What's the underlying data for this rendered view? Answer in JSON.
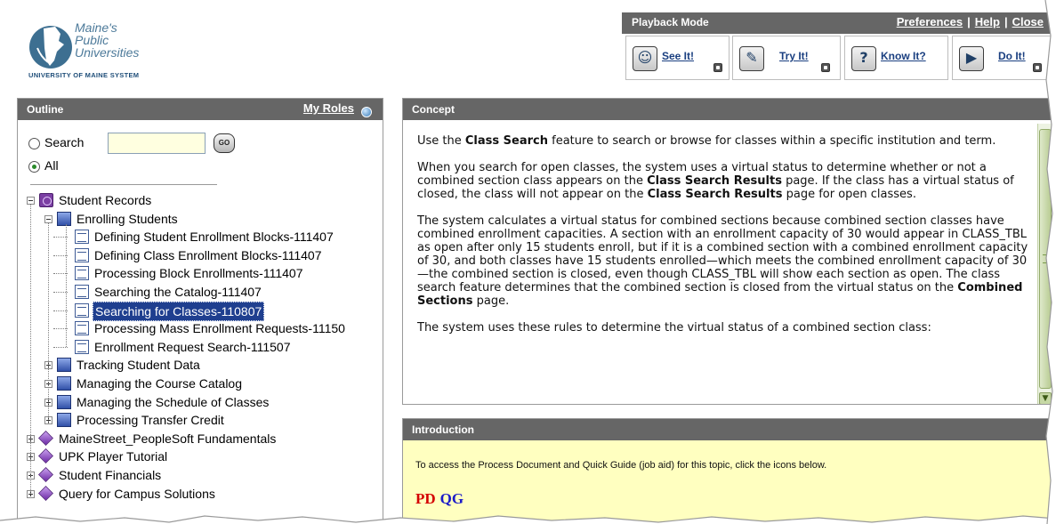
{
  "header": {
    "logo_lines": [
      "Maine's",
      "Public",
      "Universities"
    ],
    "logo_sub": "UNIVERSITY OF MAINE SYSTEM",
    "playback_title": "Playback Mode",
    "links": [
      "Preferences",
      "Help",
      "Close"
    ],
    "modes": [
      {
        "label": "See It!",
        "icon": "see-it-icon"
      },
      {
        "label": "Try It!",
        "icon": "try-it-icon"
      },
      {
        "label": "Know It?",
        "icon": "know-it-icon"
      },
      {
        "label": "Do It!",
        "icon": "do-it-icon"
      }
    ]
  },
  "outline": {
    "title": "Outline",
    "my_roles": "My Roles",
    "search_label": "Search",
    "search_value": "",
    "go_label": "GO",
    "all_label": "All",
    "selected_radio": "All",
    "tree": [
      {
        "label": "Student Records",
        "level": 0,
        "type": "book",
        "expanded": true
      },
      {
        "label": "Enrolling Students",
        "level": 1,
        "type": "folder",
        "expanded": true
      },
      {
        "label": "Defining Student Enrollment Blocks-111407",
        "level": 2,
        "type": "doc"
      },
      {
        "label": "Defining Class Enrollment Blocks-111407",
        "level": 2,
        "type": "doc"
      },
      {
        "label": "Processing Block Enrollments-111407",
        "level": 2,
        "type": "doc"
      },
      {
        "label": "Searching the Catalog-111407",
        "level": 2,
        "type": "doc"
      },
      {
        "label": "Searching for Classes-110807",
        "level": 2,
        "type": "doc",
        "selected": true
      },
      {
        "label": "Processing Mass Enrollment Requests-11150",
        "level": 2,
        "type": "doc"
      },
      {
        "label": "Enrollment Request Search-111507",
        "level": 2,
        "type": "doc"
      },
      {
        "label": "Tracking Student Data",
        "level": 1,
        "type": "folder",
        "expanded": false
      },
      {
        "label": "Managing the Course Catalog",
        "level": 1,
        "type": "folder",
        "expanded": false
      },
      {
        "label": "Managing the Schedule of Classes",
        "level": 1,
        "type": "folder",
        "expanded": false
      },
      {
        "label": "Processing Transfer Credit",
        "level": 1,
        "type": "folder",
        "expanded": false
      },
      {
        "label": "MaineStreet_PeopleSoft Fundamentals",
        "level": 0,
        "type": "gem",
        "expanded": false
      },
      {
        "label": "UPK Player Tutorial",
        "level": 0,
        "type": "gem",
        "expanded": false
      },
      {
        "label": "Student Financials",
        "level": 0,
        "type": "gem",
        "expanded": false
      },
      {
        "label": "Query for Campus Solutions",
        "level": 0,
        "type": "gem",
        "expanded": false
      }
    ]
  },
  "concept": {
    "title": "Concept",
    "paragraphs": [
      [
        {
          "t": "Use the "
        },
        {
          "t": "Class Search",
          "b": true
        },
        {
          "t": " feature to search or browse for classes within a specific institution and term."
        }
      ],
      [
        {
          "t": "When you search for open classes, the system uses a virtual status to determine whether or not a combined section class appears on the "
        },
        {
          "t": "Class Search Results",
          "b": true
        },
        {
          "t": " page. If the class has a virtual status of closed, the class will not appear on the "
        },
        {
          "t": "Class Search Results",
          "b": true
        },
        {
          "t": " page for open classes."
        }
      ],
      [
        {
          "t": "The system calculates a virtual status for combined sections because combined section classes have combined enrollment capacities. A section with an enrollment capacity of 30 would appear in CLASS_TBL as open after only 15 students enroll, but if it is a combined section with a combined enrollment capacity of 30, and both classes have 15 students enrolled—which meets the combined enrollment capacity of 30—the combined section is closed, even though CLASS_TBL will show each section as open. The class search feature determines that the combined section is closed from the virtual status on the "
        },
        {
          "t": "Combined Sections",
          "b": true
        },
        {
          "t": " page."
        }
      ],
      [
        {
          "t": "The system uses these rules to determine the virtual status of a combined section class:"
        }
      ]
    ]
  },
  "introduction": {
    "title": "Introduction",
    "text": "To access the Process Document and Quick Guide (job aid) for this topic, click the icons below.",
    "pd": "PD",
    "qg": "QG"
  }
}
